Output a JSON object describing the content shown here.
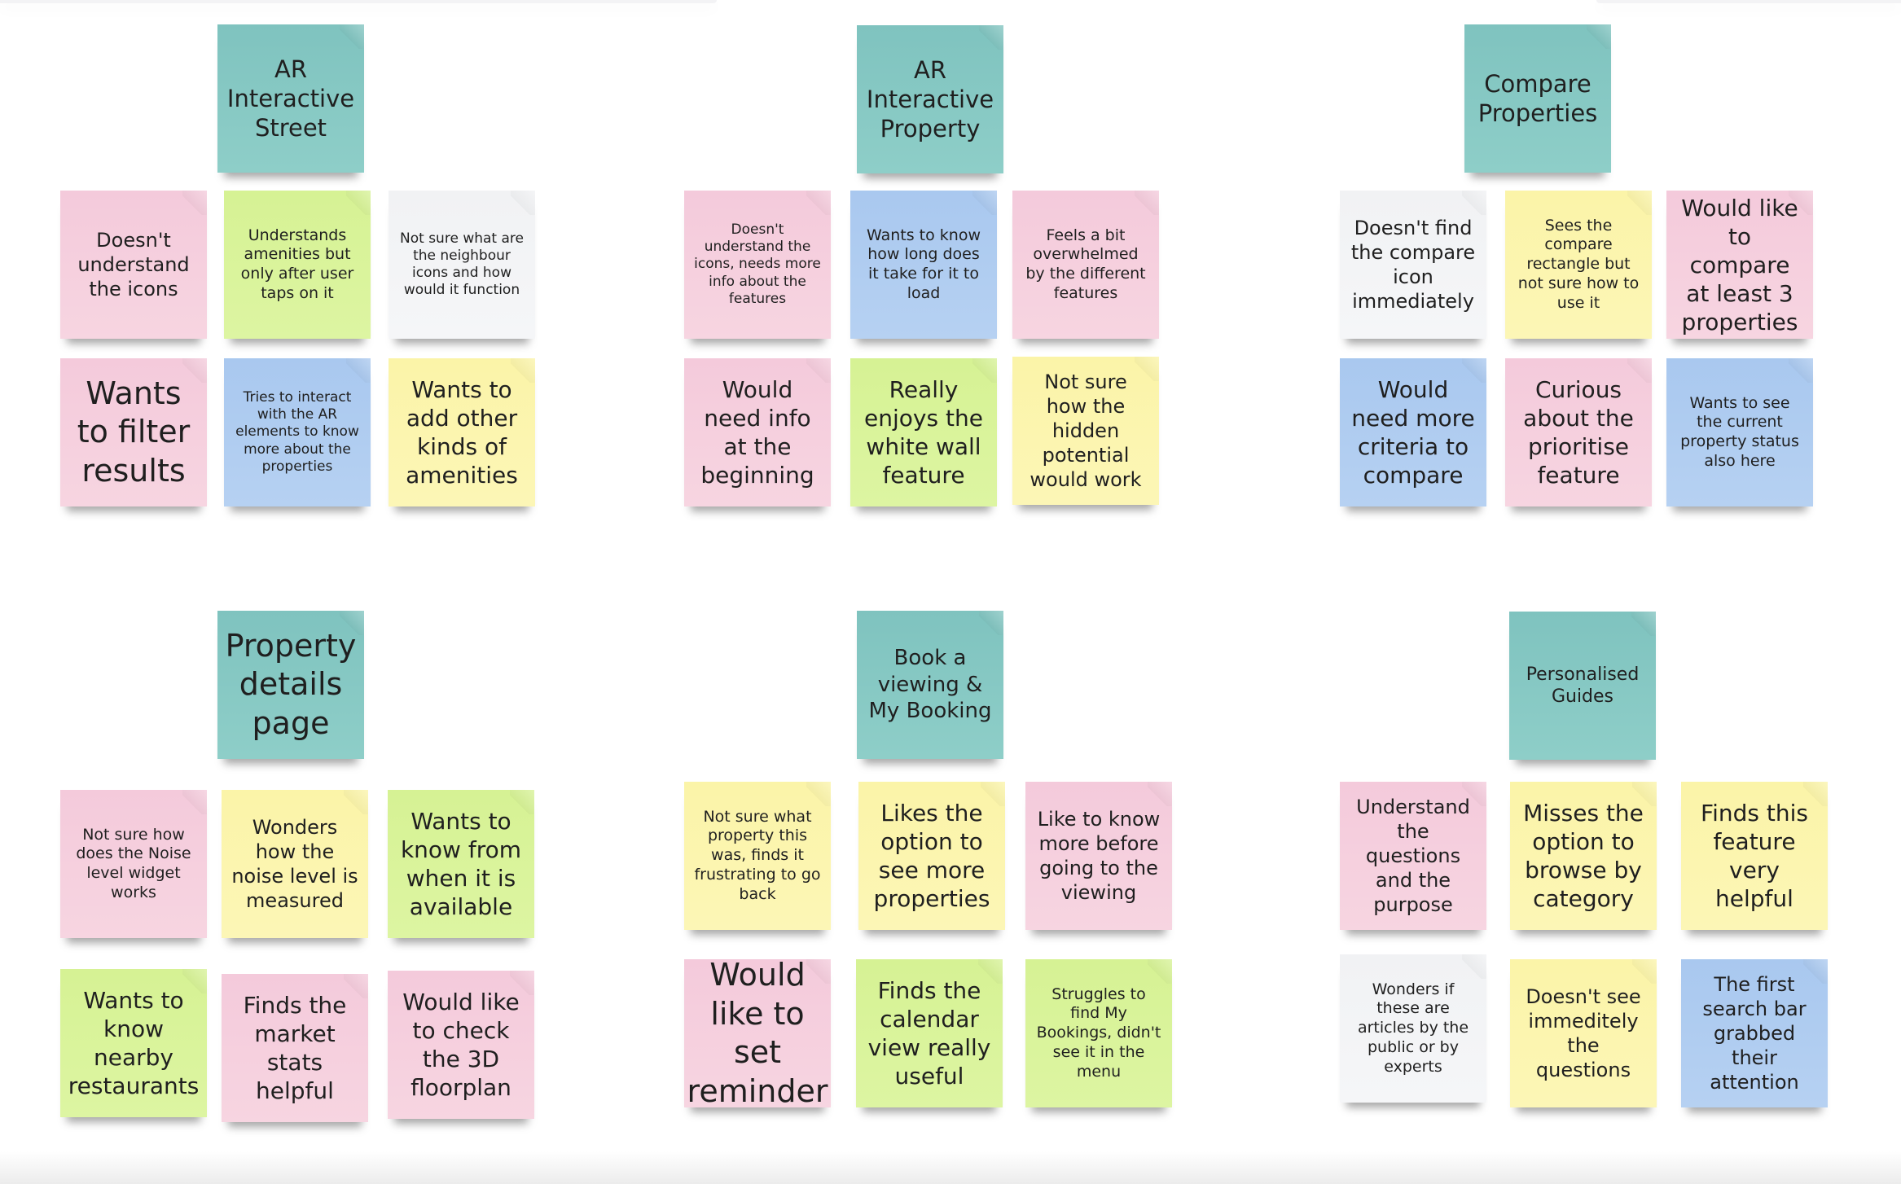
{
  "board": {
    "colors": {
      "header": "#80c4bf",
      "pink": "#f5cfdd",
      "green": "#d9f39b",
      "white": "#f3f4f6",
      "blue": "#afcdf1",
      "yellow": "#fbf5af"
    },
    "groups": [
      {
        "title": "AR Interactive Street",
        "notes": [
          {
            "text": "Doesn't understand the icons",
            "color": "pink"
          },
          {
            "text": "Understands amenities but only after user taps on it",
            "color": "green"
          },
          {
            "text": "Not sure what are the neighbour icons and how would it function",
            "color": "white"
          },
          {
            "text": "Wants to filter results",
            "color": "pink"
          },
          {
            "text": "Tries to interact with the AR elements to know more about the properties",
            "color": "blue"
          },
          {
            "text": "Wants to add other kinds of amenities",
            "color": "yellow"
          }
        ]
      },
      {
        "title": "AR Interactive Property",
        "notes": [
          {
            "text": "Doesn't understand the icons, needs more info about the features",
            "color": "pink"
          },
          {
            "text": "Wants to know how long does it take for it to load",
            "color": "blue"
          },
          {
            "text": "Feels a bit overwhelmed by the different features",
            "color": "pink"
          },
          {
            "text": "Would need info at the beginning",
            "color": "pink"
          },
          {
            "text": "Really enjoys the white wall feature",
            "color": "green"
          },
          {
            "text": "Not sure how the hidden potential would work",
            "color": "yellow"
          }
        ]
      },
      {
        "title": "Compare Properties",
        "notes": [
          {
            "text": "Doesn't find the compare icon immediately",
            "color": "white"
          },
          {
            "text": "Sees the compare rectangle but not sure how to use it",
            "color": "yellow"
          },
          {
            "text": "Would like to compare at least 3 properties",
            "color": "pink"
          },
          {
            "text": "Would need more criteria to compare",
            "color": "blue"
          },
          {
            "text": "Curious about the prioritise feature",
            "color": "pink"
          },
          {
            "text": "Wants to see the current property status also here",
            "color": "blue"
          }
        ]
      },
      {
        "title": "Property details page",
        "notes": [
          {
            "text": "Not sure how does the Noise level widget works",
            "color": "pink"
          },
          {
            "text": "Wonders how the noise level is measured",
            "color": "yellow"
          },
          {
            "text": "Wants to know from when it is available",
            "color": "green"
          },
          {
            "text": "Wants to know nearby restaurants",
            "color": "green"
          },
          {
            "text": "Finds the market stats helpful",
            "color": "pink"
          },
          {
            "text": "Would like to check the 3D floorplan",
            "color": "pink"
          }
        ]
      },
      {
        "title": "Book a viewing & My Booking",
        "notes": [
          {
            "text": "Not sure what property this was, finds it frustrating to go back",
            "color": "yellow"
          },
          {
            "text": "Likes the option to see more properties",
            "color": "yellow"
          },
          {
            "text": "Like to know more before going to the viewing",
            "color": "pink"
          },
          {
            "text": "Would like to set reminder",
            "color": "pink"
          },
          {
            "text": "Finds the calendar view really useful",
            "color": "green"
          },
          {
            "text": "Struggles to find My Bookings, didn't see it in the menu",
            "color": "green"
          }
        ]
      },
      {
        "title": "Personalised Guides",
        "notes": [
          {
            "text": "Understand the questions and the purpose",
            "color": "pink"
          },
          {
            "text": "Misses the option to browse by category",
            "color": "yellow"
          },
          {
            "text": "Finds this feature very helpful",
            "color": "yellow"
          },
          {
            "text": "Wonders if these are articles by the public or by experts",
            "color": "white"
          },
          {
            "text": "Doesn't see immeditely the questions",
            "color": "yellow"
          },
          {
            "text": "The first search bar grabbed their attention",
            "color": "blue"
          }
        ]
      }
    ]
  }
}
